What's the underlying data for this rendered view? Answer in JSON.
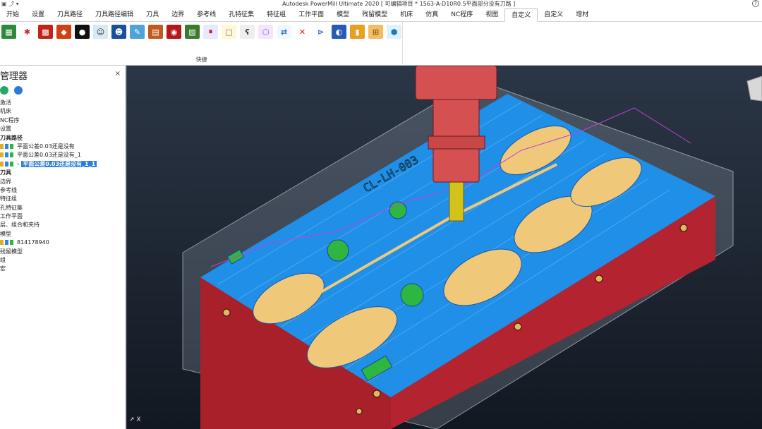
{
  "titlebar": {
    "quick_access": "▣ ⤴ ▾",
    "title": "Autodesk PowerMill Ultimate 2020   [ 可编辑项目 * 1563-A-D10R0.5平面部分没有刀路 ]",
    "help": "?"
  },
  "tabs": [
    "开始",
    "设置",
    "刀具路径",
    "刀具路径编辑",
    "刀具",
    "边界",
    "参考线",
    "孔特征集",
    "特征组",
    "工作平面",
    "模型",
    "残留模型",
    "机床",
    "仿真",
    "NC程序",
    "视图",
    "自定义",
    "自定义",
    "增材"
  ],
  "active_tab_index": 16,
  "ribbon": {
    "group_label": "快捷",
    "icons": [
      {
        "name": "grid-green-icon",
        "color": "#2c8a3a",
        "glyph": "▦"
      },
      {
        "name": "star-red-icon",
        "color": "#ffffff",
        "glyph": "✱",
        "fg": "#cc2020"
      },
      {
        "name": "red-green-block-icon",
        "color": "#c02418",
        "glyph": "▩"
      },
      {
        "name": "red-cube-icon",
        "color": "#d04010",
        "glyph": "◆"
      },
      {
        "name": "black-head-icon",
        "color": "#111111",
        "glyph": "●"
      },
      {
        "name": "face-icon",
        "color": "#d7e9f5",
        "glyph": "☺",
        "fg": "#333"
      },
      {
        "name": "blue-face-icon",
        "color": "#1a4f9a",
        "glyph": "☻"
      },
      {
        "name": "paint-icon",
        "color": "#4fa3d8",
        "glyph": "✎"
      },
      {
        "name": "brick-icon",
        "color": "#c05a20",
        "glyph": "▤"
      },
      {
        "name": "red-disc-icon",
        "color": "#b41818",
        "glyph": "◉"
      },
      {
        "name": "mesh-icon",
        "color": "#3a7a2a",
        "glyph": "▧"
      },
      {
        "name": "split-icon",
        "color": "#e8e8ff",
        "glyph": "⏸",
        "fg": "#c01010"
      },
      {
        "name": "blank-page-icon",
        "color": "#fff8d8",
        "glyph": "□",
        "fg": "#777"
      },
      {
        "name": "bear-icon",
        "color": "#eeeeee",
        "glyph": "ʕ",
        "fg": "#333"
      },
      {
        "name": "iso-box-icon",
        "color": "#f2e6ff",
        "glyph": "⬡",
        "fg": "#8a5ab8"
      },
      {
        "name": "arrows-icon",
        "color": "#f0f8ff",
        "glyph": "⇄",
        "fg": "#1a6bc8"
      },
      {
        "name": "red-x-icon",
        "color": "#ffffff",
        "glyph": "✕",
        "fg": "#e01818"
      },
      {
        "name": "tool-arrow-icon",
        "color": "#ffffff",
        "glyph": "⊳",
        "fg": "#4a7ab8"
      },
      {
        "name": "globe-icon",
        "color": "#2a5ab8",
        "glyph": "◐"
      },
      {
        "name": "color-bars-icon",
        "color": "#e8a020",
        "glyph": "▮"
      },
      {
        "name": "grid-orange-icon",
        "color": "#f0c060",
        "glyph": "⊞",
        "fg": "#a0502a"
      },
      {
        "name": "box-blue-icon",
        "color": "#dff0ff",
        "glyph": "⬢",
        "fg": "#1a7ab8"
      }
    ]
  },
  "explorer": {
    "title": "管理器",
    "close": "×",
    "tools": [
      {
        "name": "globe-icon",
        "color": "#2aa56a"
      },
      {
        "name": "trash-icon",
        "color": "#2a7ad8"
      }
    ],
    "items": [
      {
        "label": "激活",
        "bold": false,
        "indent": 0
      },
      {
        "label": "机床",
        "bold": false,
        "indent": 0
      },
      {
        "label": "NC程序",
        "bold": false,
        "indent": 0
      },
      {
        "label": "设置",
        "bold": false,
        "indent": 0
      },
      {
        "label": "刀具路径",
        "bold": true,
        "indent": 0
      },
      {
        "label": "平面公差0.03还是没有",
        "bold": false,
        "indent": 1
      },
      {
        "label": "平面公差0.03还是没有_1",
        "bold": false,
        "indent": 1
      },
      {
        "label": "平面公差0.03还是没有_1_1",
        "bold": true,
        "indent": 1,
        "selected": true
      },
      {
        "label": "刀具",
        "bold": true,
        "indent": 0
      },
      {
        "label": "边界",
        "bold": false,
        "indent": 0
      },
      {
        "label": "参考线",
        "bold": false,
        "indent": 0
      },
      {
        "label": "特征组",
        "bold": false,
        "indent": 0
      },
      {
        "label": "孔特征集",
        "bold": false,
        "indent": 0
      },
      {
        "label": "工作平面",
        "bold": false,
        "indent": 0
      },
      {
        "label": "层、组合和夹持",
        "bold": false,
        "indent": 0
      },
      {
        "label": "模型",
        "bold": false,
        "indent": 0
      },
      {
        "label": "814178940",
        "bold": false,
        "indent": 1
      },
      {
        "label": "残留模型",
        "bold": false,
        "indent": 0
      },
      {
        "label": "组",
        "bold": false,
        "indent": 0
      },
      {
        "label": "宏",
        "bold": false,
        "indent": 0
      }
    ]
  },
  "viewport": {
    "triad_label": "X",
    "part_engraving": "CL-LH-003",
    "colors": {
      "block": "#a8212a",
      "top": "#1f8fe8",
      "pocket": "#f0c87a",
      "spindle": "#d55050",
      "tool": "#d2c21a",
      "green": "#2fb640"
    }
  }
}
